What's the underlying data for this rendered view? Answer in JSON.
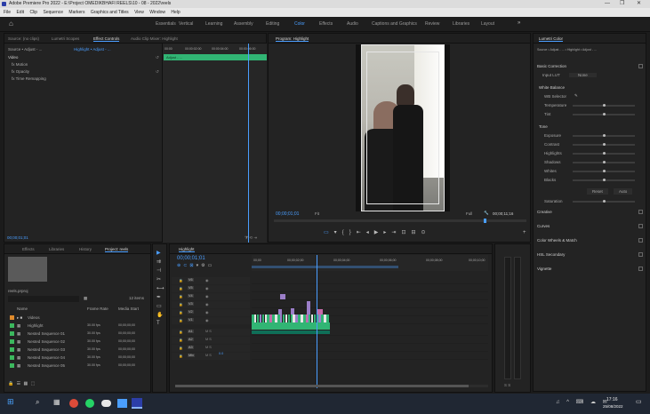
{
  "window": {
    "title": "Adobe Premiere Pro 2022 - E:\\Project OMEDIKBHAFI REELS\\10 - 08 - 2022\\reels",
    "controls": [
      "—",
      "❐",
      "✕"
    ]
  },
  "menu": [
    "File",
    "Edit",
    "Clip",
    "Sequence",
    "Markers",
    "Graphics and Titles",
    "View",
    "Window",
    "Help"
  ],
  "workspaces": {
    "items": [
      "Essentials",
      "Vertical",
      "Learning",
      "Assembly",
      "Editing",
      "Color",
      "Effects",
      "Audio",
      "Captions and Graphics",
      "Review",
      "Libraries",
      "Layout"
    ],
    "active": "Color"
  },
  "effect_controls": {
    "tabs": [
      "Source: (no clips)",
      "Lumetri Scopes",
      "Effect Controls",
      "Audio Clip Mixer: Highlight"
    ],
    "active_tab": "Effect Controls",
    "source_line": "Source • Adjust - ...",
    "sequence_link": "Highlight • Adjust - ...",
    "video_header": "Video",
    "items": [
      "fx  Motion",
      "fx  Opacity",
      "fx  Time Remapping"
    ],
    "timecodes": [
      "00:00",
      "00:00:02:00",
      "00:00:04:00",
      "00:00:06:00"
    ],
    "clip_label": "Adjust - ..."
  },
  "program_monitor": {
    "tab": "Program: Highlight",
    "timecode": "00;00;01;01",
    "fit": "Fit",
    "quality": "Full",
    "duration": "00;00;11;16"
  },
  "lumetri": {
    "tab": "Lumetri Color",
    "source": "Source • Adjust - ... • Highlight • Adjust - ...",
    "sections": [
      "Basic Correction",
      "White Balance",
      "Tone",
      "Creative",
      "Curves",
      "Color Wheels & Match",
      "HSL Secondary",
      "Vignette"
    ],
    "input_lut": "Input LUT",
    "none": "None",
    "wb_rows": [
      "WB Selector",
      "Temperature",
      "Tint"
    ],
    "tone_rows": [
      "Exposure",
      "Contrast",
      "Highlights",
      "Shadows",
      "Whites",
      "Blacks",
      "Saturation"
    ],
    "reset": "Reset",
    "auto": "Auto"
  },
  "project": {
    "tabs": [
      "Effects",
      "Libraries",
      "History",
      "Project: reels"
    ],
    "active_tab": "Project: reels",
    "timecode": "00;00;01;01",
    "file_name": "reels.prproj",
    "columns": [
      "Name",
      "Frame Rate",
      "Media Start"
    ],
    "items": [
      {
        "name": "Videos",
        "rate": "",
        "start": ""
      },
      {
        "name": "Highlight",
        "rate": "30.00 fps",
        "start": "00;00;00;00"
      },
      {
        "name": "Nested Sequence 01",
        "rate": "30.00 fps",
        "start": "00;00;00;00"
      },
      {
        "name": "Nested Sequence 02",
        "rate": "30.00 fps",
        "start": "00;00;00;00"
      },
      {
        "name": "Nested Sequence 03",
        "rate": "30.00 fps",
        "start": "00;00;00;00"
      },
      {
        "name": "Nested Sequence 04",
        "rate": "30.00 fps",
        "start": "00;00;00;00"
      },
      {
        "name": "Nested Sequence 05",
        "rate": "30.00 fps",
        "start": "00;00;00;00"
      }
    ],
    "count": "12 items"
  },
  "timeline": {
    "tab": "Highlight",
    "timecode": "00;00;01;01",
    "ruler": [
      "00;00",
      "00;00;02;00",
      "00;00;04;00",
      "00;00;06;00",
      "00;00;08;00",
      "00;00;10;00"
    ],
    "tracks": [
      "V6",
      "V5",
      "V4",
      "V3",
      "V2",
      "V1",
      "A1",
      "A2",
      "A3",
      "Mix"
    ],
    "mix_value": "0.0"
  },
  "taskbar": {
    "time": "17:16",
    "date": "25/08/2022"
  },
  "colors": {
    "accent": "#4a9eff",
    "clip_green": "#31b574",
    "clip_purple": "#9b7ec8",
    "clip_pink": "#c76ba8"
  }
}
